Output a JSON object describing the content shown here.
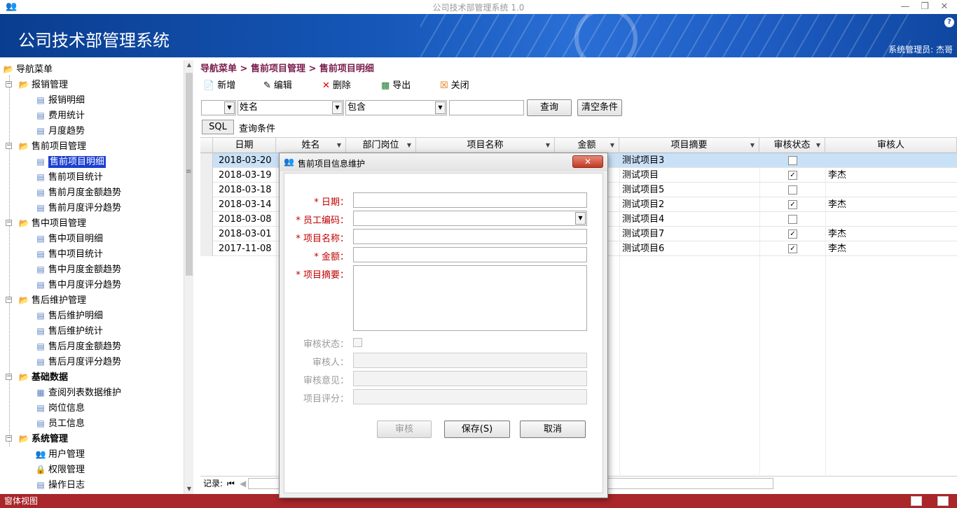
{
  "window": {
    "title": "公司技术部管理系统 1.0",
    "app_name": "公司技术部管理系统",
    "admin_label": "系统管理员: 杰哥",
    "help_glyph": "?",
    "minimize": "—",
    "restore": "❐",
    "close": "✕"
  },
  "tree": {
    "root": "导航菜单",
    "groups": [
      {
        "label": "报销管理",
        "items": [
          "报销明细",
          "费用统计",
          "月度趋势"
        ]
      },
      {
        "label": "售前项目管理",
        "items": [
          "售前项目明细",
          "售前项目统计",
          "售前月度金额趋势",
          "售前月度评分趋势"
        ]
      },
      {
        "label": "售中项目管理",
        "items": [
          "售中项目明细",
          "售中项目统计",
          "售中月度金额趋势",
          "售中月度评分趋势"
        ]
      },
      {
        "label": "售后维护管理",
        "items": [
          "售后维护明细",
          "售后维护统计",
          "售后月度金额趋势",
          "售后月度评分趋势"
        ]
      },
      {
        "label": "基础数据",
        "items": [
          "查阅列表数据维护",
          "岗位信息",
          "员工信息"
        ]
      },
      {
        "label": "系统管理",
        "items": [
          "用户管理",
          "权限管理",
          "操作日志"
        ]
      }
    ],
    "selected": "售前项目明细"
  },
  "breadcrumb": "导航菜单 > 售前项目管理 > 售前项目明细",
  "toolbar": {
    "new": "新增",
    "edit": "编辑",
    "delete": "删除",
    "export": "导出",
    "close": "关闭"
  },
  "filter": {
    "field1": "",
    "field": "姓名",
    "operator": "包含",
    "value": "",
    "query_button": "查询",
    "clear_button": "清空条件"
  },
  "sql": {
    "button": "SQL",
    "text": "查询条件"
  },
  "grid": {
    "columns": [
      "日期",
      "姓名",
      "部门岗位",
      "项目名称",
      "金额",
      "项目摘要",
      "审核状态",
      "审核人"
    ],
    "rows": [
      {
        "date": "2018-03-20",
        "summary": "测试项目3",
        "checked": false,
        "reviewer": ""
      },
      {
        "date": "2018-03-19",
        "summary": "测试项目",
        "checked": true,
        "reviewer": "李杰"
      },
      {
        "date": "2018-03-18",
        "summary": "测试项目5",
        "checked": false,
        "reviewer": ""
      },
      {
        "date": "2018-03-14",
        "summary": "测试项目2",
        "checked": true,
        "reviewer": "李杰"
      },
      {
        "date": "2018-03-08",
        "summary": "测试项目4",
        "checked": false,
        "reviewer": ""
      },
      {
        "date": "2018-03-01",
        "summary": "测试项目7",
        "checked": true,
        "reviewer": "李杰"
      },
      {
        "date": "2017-11-08",
        "summary": "测试项目6",
        "checked": true,
        "reviewer": "李杰"
      }
    ]
  },
  "pager": {
    "label": "记录:"
  },
  "statusbar": {
    "text": "窗体视图"
  },
  "dialog": {
    "title": "售前项目信息维护",
    "close": "✕",
    "fields": {
      "date": "* 日期：",
      "emp_code": "* 员工编码：",
      "project_name": "* 项目名称：",
      "amount": "* 金额：",
      "summary": "* 项目摘要：",
      "review_status": "审核状态：",
      "reviewer": "审核人：",
      "review_opinion": "审核意见：",
      "project_score": "项目评分："
    },
    "buttons": {
      "review": "审核",
      "save": "保存(S)",
      "cancel": "取消"
    }
  }
}
